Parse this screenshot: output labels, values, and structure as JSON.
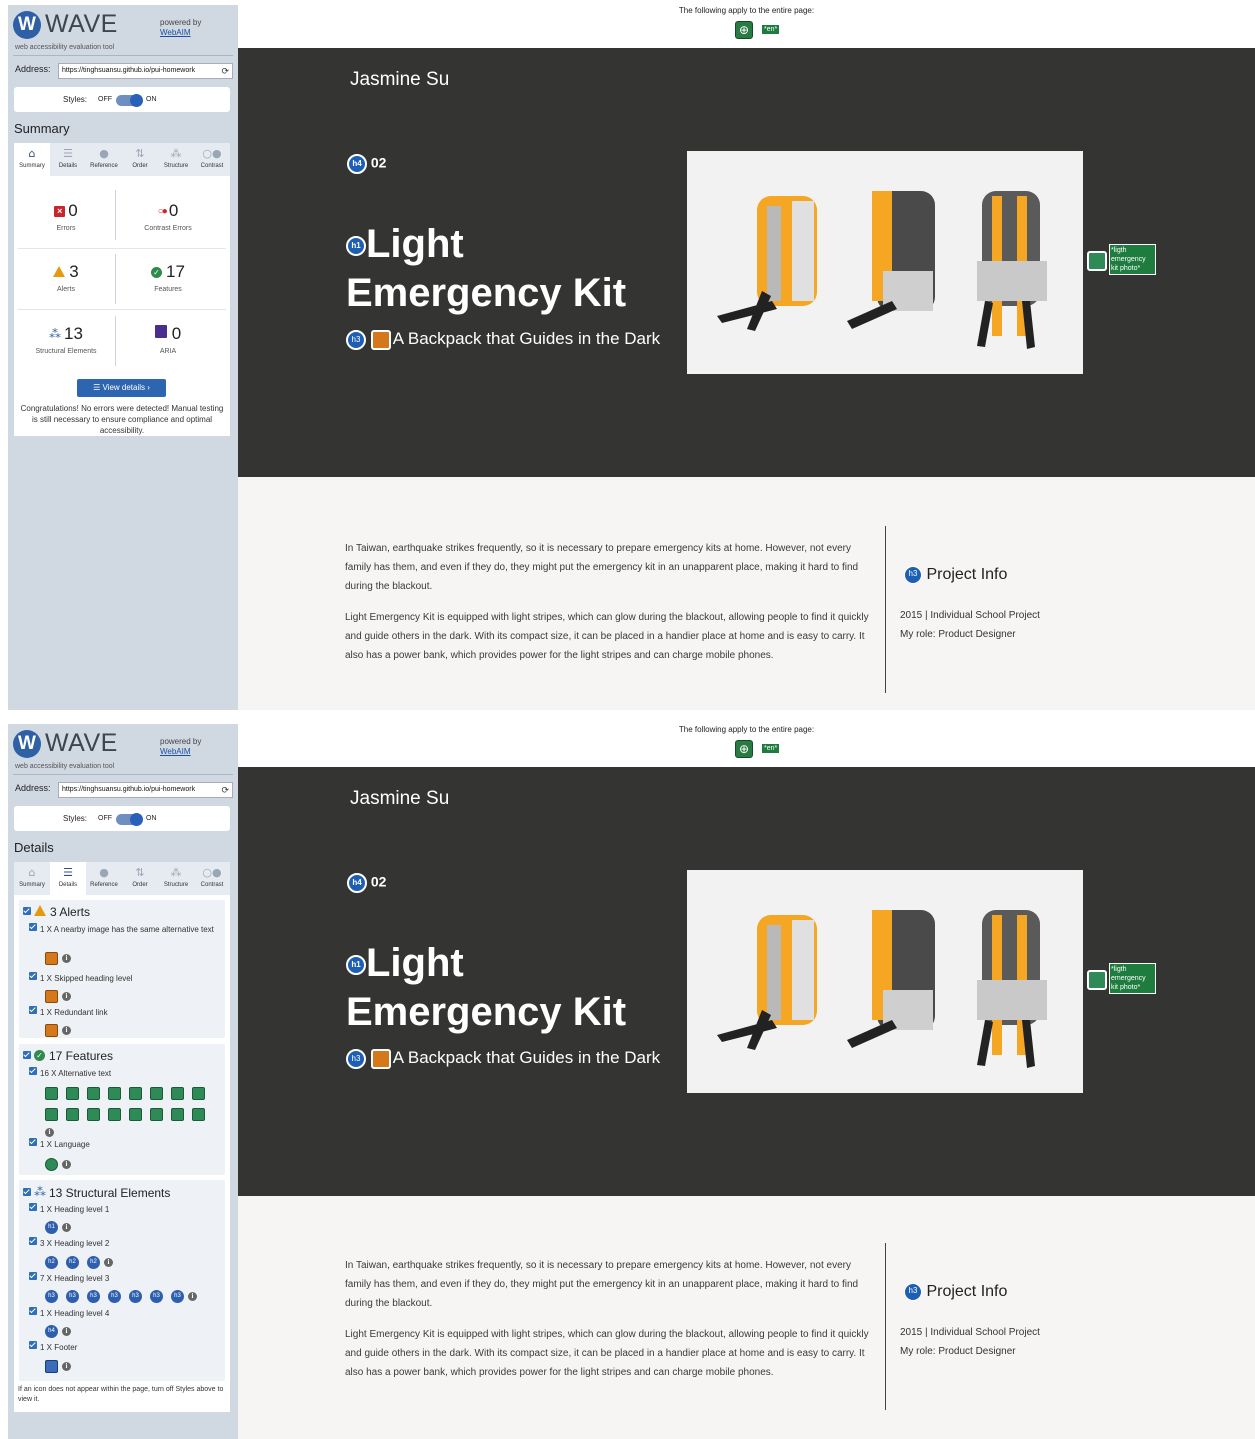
{
  "wave": {
    "logo_word": "WAVE",
    "tagline": "web accessibility evaluation tool",
    "powered_by": "powered by",
    "webaim": "WebAIM",
    "address_label": "Address:",
    "address_value": "https://tinghsuansu.github.io/pui-homework",
    "styles_label": "Styles:",
    "styles_off": "OFF",
    "styles_on": "ON",
    "tabs": [
      "Summary",
      "Details",
      "Reference",
      "Order",
      "Structure",
      "Contrast"
    ]
  },
  "summary": {
    "title": "Summary",
    "errors": {
      "value": "0",
      "label": "Errors"
    },
    "contrast_errors": {
      "value": "0",
      "label": "Contrast Errors"
    },
    "alerts": {
      "value": "3",
      "label": "Alerts"
    },
    "features": {
      "value": "17",
      "label": "Features"
    },
    "structural": {
      "value": "13",
      "label": "Structural Elements"
    },
    "aria": {
      "value": "0",
      "label": "ARIA"
    },
    "view_details": "View details ›",
    "congrats": "Congratulations! No errors were detected! Manual testing is still necessary to ensure compliance and optimal accessibility."
  },
  "details": {
    "title": "Details",
    "alerts_head": "3 Alerts",
    "alert_items": [
      "1 X A nearby image has the same alternative text",
      "1 X Skipped heading level",
      "1 X Redundant link"
    ],
    "features_head": "17 Features",
    "feature_items": [
      "16 X Alternative text",
      "1 X Language"
    ],
    "structure_head": "13 Structural Elements",
    "structure_items": [
      "1 X Heading level 1",
      "3 X Heading level 2",
      "7 X Heading level 3",
      "1 X Heading level 4",
      "1 X Footer"
    ],
    "note": "If an icon does not appear within the page, turn off Styles above to view it."
  },
  "page": {
    "top_note": "The following apply to the entire page:",
    "lang_tag": "*en*",
    "author": "Jasmine Su",
    "number": "02",
    "title_line1": "Light",
    "title_line2": "Emergency Kit",
    "subtitle": "A Backpack that Guides in the Dark",
    "alt_tag": "*ligth emergency kit photo*",
    "para1": "In Taiwan, earthquake strikes frequently, so it is necessary to prepare emergency kits at home. However, not every family has them, and even if they do, they might put the emergency kit in an unapparent place, making it hard to find during the blackout.",
    "para2": "Light Emergency Kit is equipped with light stripes, which can glow during the blackout, allowing people to find it quickly and guide others in the dark. With its compact size, it can be placed in a handier place at home and is easy to carry. It also has a power bank, which provides power for the light stripes and can charge mobile phones.",
    "info_title": "Project Info",
    "info_line1": "2015 | Individual School Project",
    "info_line2": "My role: Product Designer"
  },
  "badges": {
    "h1": "h1",
    "h2": "h2",
    "h3": "h3",
    "h4": "h4",
    "info": "i"
  },
  "colors": {
    "hero_bg": "#343432",
    "wave_blue": "#2e65b0",
    "feature_green": "#2e8b57",
    "alert_orange": "#d5781c"
  }
}
